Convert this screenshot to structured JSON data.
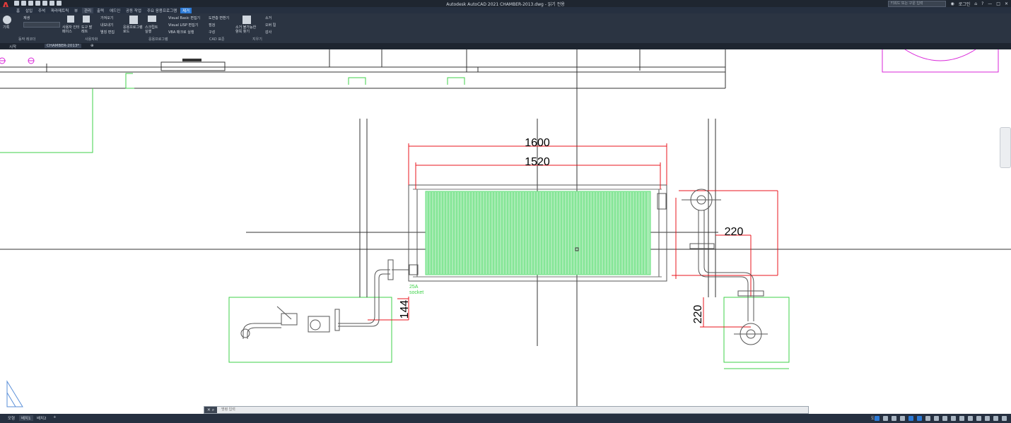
{
  "window": {
    "title": "Autodesk AutoCAD 2021    CHAMBER-2013.dwg - 읽기 전용",
    "search_placeholder": "키워드 또는 구문 입력",
    "login_label": "로그인"
  },
  "ribbon_tabs": [
    "홈",
    "삽입",
    "주석",
    "파라메트릭",
    "뷰",
    "관리",
    "출력",
    "애드인",
    "공동 작업",
    "주요 응용프로그램",
    "제거"
  ],
  "ribbon": {
    "record_label": "기록",
    "play_label": "재생",
    "action_recorder_label": "동작 레코더",
    "user_interface_label": "사용자 인터페이스",
    "tool_palettes_label": "도구 팔레트",
    "import_label": "가져오기",
    "export_label": "내보내기",
    "alias_edit_label": "별칭 편집",
    "customize_label": "사용자화",
    "load_app_label": "응용프로그램 로드",
    "run_script_label": "스크립트 실행",
    "vba_editor_label": "Visual Basic 편집기",
    "lisp_editor_label": "Visual LISP 편집기",
    "run_vba_label": "VBA 매크로 실행",
    "applications_label": "응용프로그램",
    "cad_standards_label": "CAD 표준",
    "layer_translator_label": "도면층 변환기",
    "check_label": "점검",
    "configure_label": "구성",
    "find_nonpurgeable_label": "소거 불가능한 항목 찾기",
    "purge_label": "소거",
    "overkill_label": "오버 킬",
    "audit_label": "감사",
    "cleanup_label": "지우기"
  },
  "doc_tabs": {
    "start_label": "시작",
    "file_label": "CHAMBER-2013*"
  },
  "drawing": {
    "dim_1600": "1600",
    "dim_1520": "1520",
    "dim_220_right": "220",
    "dim_144": "144",
    "dim_220_bottom": "220",
    "label_25a": "25A",
    "label_socket": "socket"
  },
  "command_line": {
    "placeholder": "명령 입력"
  },
  "layout_tabs": [
    "모형",
    "배치1",
    "배치2"
  ],
  "status": {
    "model_label": "도면"
  },
  "colors": {
    "ribbon_bg": "#2b3442",
    "accent": "#2c7ad6",
    "dimension_red": "#e8141c",
    "coil_green": "#62e07a",
    "pipe_gray": "#5a5a5a",
    "magenta": "#d926d9",
    "green_outline": "#3fd24a"
  }
}
